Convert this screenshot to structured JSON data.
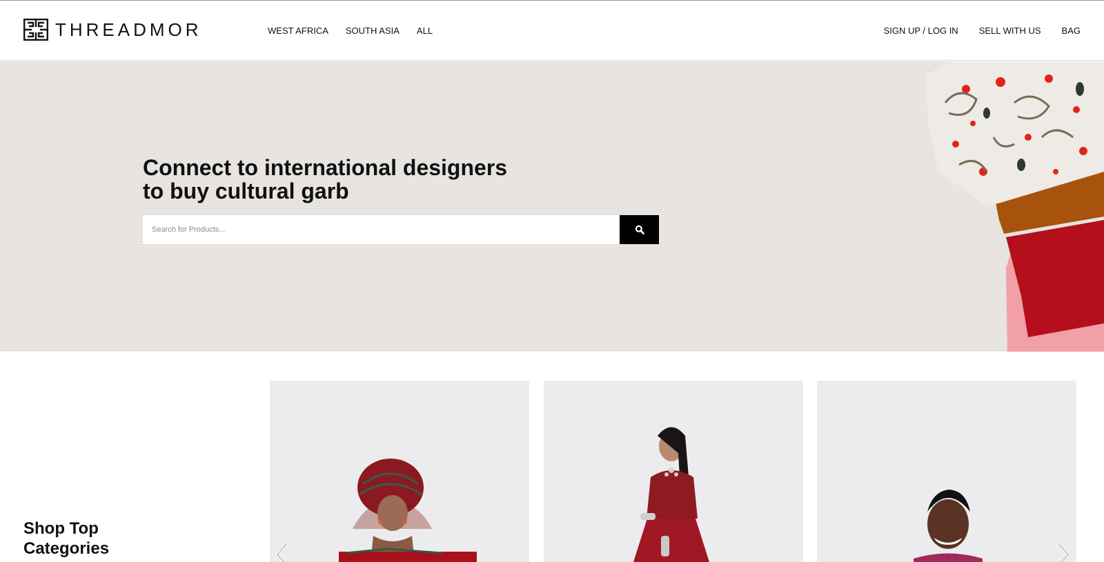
{
  "brand": {
    "name": "THREADMOR",
    "logo_icon": "threadmor-maze-logo-icon"
  },
  "nav": {
    "left": [
      {
        "label": "WEST AFRICA"
      },
      {
        "label": "SOUTH ASIA"
      },
      {
        "label": "ALL"
      }
    ],
    "right": [
      {
        "label": "SIGN UP / LOG IN"
      },
      {
        "label": "SELL WITH US"
      },
      {
        "label": "BAG"
      }
    ]
  },
  "hero": {
    "title_line1": "Connect to international designers",
    "title_line2": "to buy cultural garb",
    "search": {
      "placeholder": "Search for Products...",
      "value": "",
      "button_icon": "search-icon"
    }
  },
  "categories": {
    "heading_line1": "Shop Top",
    "heading_line2": "Categories",
    "cards": [
      {
        "image": "woman-in-red-gele-west-african-attire"
      },
      {
        "image": "woman-in-red-embroidered-lehenga"
      },
      {
        "image": "young-man-smiling"
      }
    ],
    "prev_icon": "chevron-left-icon",
    "next_icon": "chevron-right-icon"
  },
  "colors": {
    "search_button": "#000000",
    "hero_background": "#e7e4e1",
    "card_background": "#ececef",
    "accent_red": "#a8101a"
  }
}
